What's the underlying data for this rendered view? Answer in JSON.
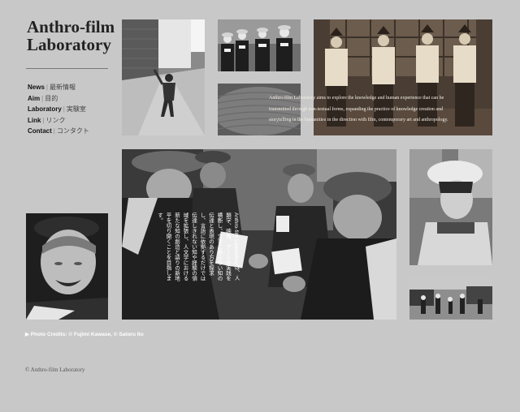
{
  "site": {
    "title_line1": "Anthro-film",
    "title_line2": "Laboratory"
  },
  "nav": {
    "items": [
      {
        "en": "News",
        "ja": "最新情報"
      },
      {
        "en": "Aim",
        "ja": "目的"
      },
      {
        "en": "Laboratory",
        "ja": "実験室"
      },
      {
        "en": "Link",
        "ja": "リンク"
      },
      {
        "en": "Contact",
        "ja": "コンタクト"
      }
    ],
    "separator": "|"
  },
  "intro": {
    "en": "Anthro-film Laboratory aims to explore the knowledge and human experience that can be transmitted through non-textual forms, expanding the practice of knowledge creation and storytelling in the humanities in the direction with film, contemporary art and anthropology.",
    "ja": "Anthro-film Laboratoryは、人類学、映像、アートの実践を横断し、文字に依らない知の伝達と表現のあり方を探求し、言語に依拠するだけでは伝達しきれない知や経験の領域を拡張し、人文学における新たな知の創造と語りの新地平を切り開くことを目指します。"
  },
  "credits": "▶ Photo Credits: © Fujimi Kawase, © Satoru Ito",
  "copyright": "© Anthro-film Laboratory",
  "photos": {
    "street_child": "child-in-street-photo",
    "group_women": "group-of-women-photo",
    "four_girls": "four-girls-in-costume-photo",
    "basket": "woven-basket-photo",
    "card_players": "elderly-men-playing-cards-photo",
    "smiling_woman": "smiling-elderly-woman-photo",
    "girl_hat": "girl-in-hat-photo",
    "market": "market-street-photo"
  }
}
